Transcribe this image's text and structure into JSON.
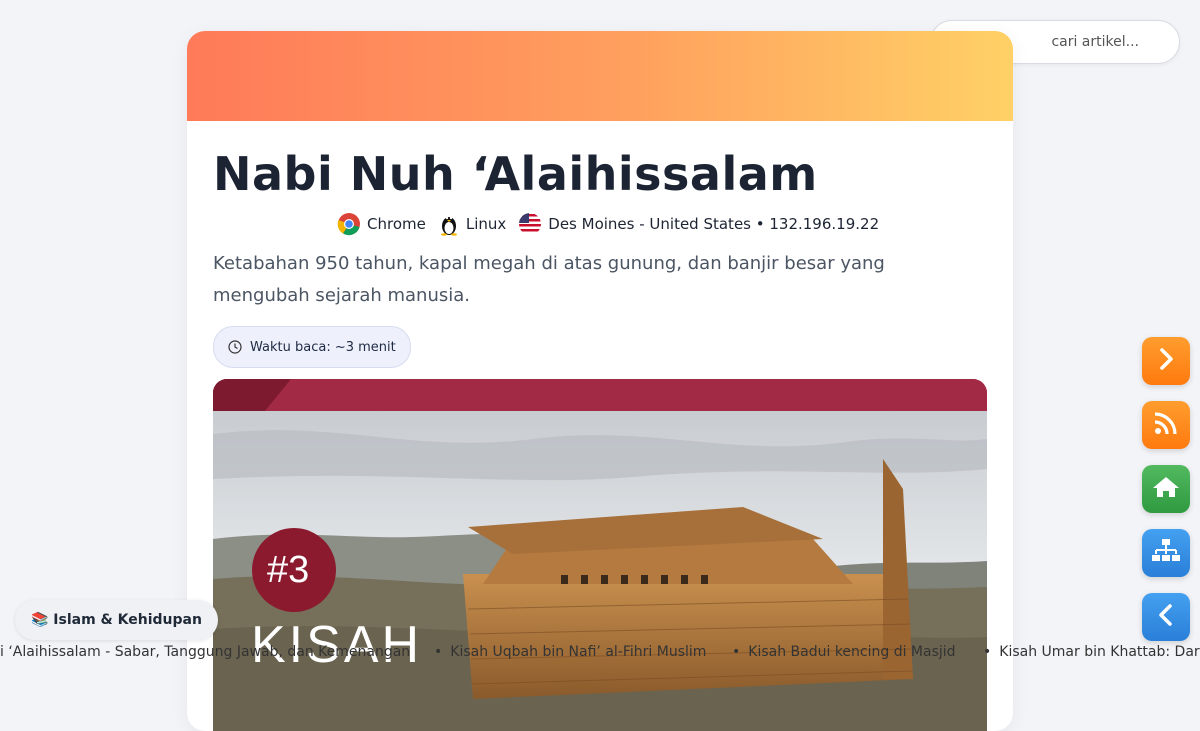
{
  "article": {
    "title": "Nabi Nuh ‘Alaihissalam",
    "browser": "Chrome",
    "os": "Linux",
    "location": "Des Moines - United States • 132.196.19.22",
    "description": "Ketabahan 950 tahun, kapal megah di atas gunung, dan banjir besar yang mengubah sejarah manusia.",
    "reading_time": "Waktu baca: ~3 menit"
  },
  "hero": {
    "badge": "#3",
    "caption": "KISAH"
  },
  "search": {
    "placeholder": "cari artikel..."
  },
  "category_chip": {
    "label": "📚 Islam & Kehidupan"
  },
  "ticker": {
    "items": [
      "i ‘Alaihissalam - Sabar, Tanggung Jawab, dan Kemenangan",
      "Kisah Uqbah bin Nafi’ al-Fihri Muslim",
      "Kisah Badui kencing di Masjid",
      "Kisah Umar bin Khattab: Dari"
    ]
  },
  "colors": {
    "banner_start": "#ff7a59",
    "banner_end": "#ffd166",
    "fab_next": "#ff8a1c",
    "fab_rss": "#ff8a1c",
    "fab_home": "#3faa4e",
    "fab_sitemap": "#2f8fe6",
    "fab_prev": "#2f8fe6"
  },
  "icons": {
    "browser": "chrome-icon",
    "os": "linux-tux-icon",
    "flag": "us-flag-icon",
    "clock": "clock-icon",
    "search": "search-icon",
    "next": "chevron-right-icon",
    "rss": "rss-icon",
    "home": "home-icon",
    "sitemap": "sitemap-icon",
    "prev": "chevron-left-icon"
  }
}
